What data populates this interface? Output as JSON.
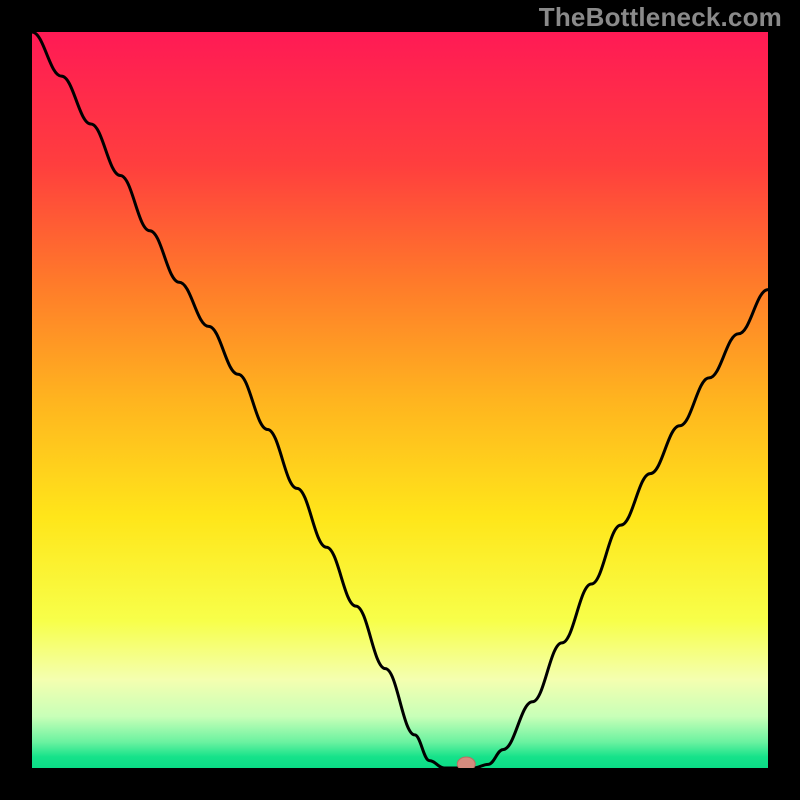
{
  "watermark": {
    "text": "TheBottleneck.com"
  },
  "colors": {
    "bg_black": "#000000",
    "curve": "#000000",
    "marker_fill": "#d58b7e",
    "marker_stroke": "#b86f63",
    "watermark": "#8a8a8a",
    "gradient_stops": [
      {
        "offset": 0.0,
        "color": "#ff1a55"
      },
      {
        "offset": 0.18,
        "color": "#ff3e3e"
      },
      {
        "offset": 0.34,
        "color": "#ff7a2a"
      },
      {
        "offset": 0.5,
        "color": "#ffb41f"
      },
      {
        "offset": 0.66,
        "color": "#ffe61a"
      },
      {
        "offset": 0.8,
        "color": "#f7ff4a"
      },
      {
        "offset": 0.88,
        "color": "#f4ffb0"
      },
      {
        "offset": 0.93,
        "color": "#c8ffb8"
      },
      {
        "offset": 0.965,
        "color": "#6af2a0"
      },
      {
        "offset": 0.985,
        "color": "#15e28a"
      },
      {
        "offset": 1.0,
        "color": "#0bdc86"
      }
    ]
  },
  "chart_data": {
    "type": "line",
    "title": "",
    "xlabel": "",
    "ylabel": "",
    "xlim": [
      0,
      100
    ],
    "ylim": [
      0,
      100
    ],
    "x": [
      0,
      4,
      8,
      12,
      16,
      20,
      24,
      28,
      32,
      36,
      40,
      44,
      48,
      52,
      54,
      56,
      58,
      60,
      62,
      64,
      68,
      72,
      76,
      80,
      84,
      88,
      92,
      96,
      100
    ],
    "values": [
      100.0,
      94.0,
      87.5,
      80.5,
      73.0,
      66.0,
      60.0,
      53.5,
      46.0,
      38.0,
      30.0,
      22.0,
      13.5,
      4.5,
      1.0,
      0.0,
      0.0,
      0.0,
      0.5,
      2.5,
      9.0,
      17.0,
      25.0,
      33.0,
      40.0,
      46.5,
      53.0,
      59.0,
      65.0
    ],
    "marker": {
      "x": 59,
      "y": 0
    }
  }
}
